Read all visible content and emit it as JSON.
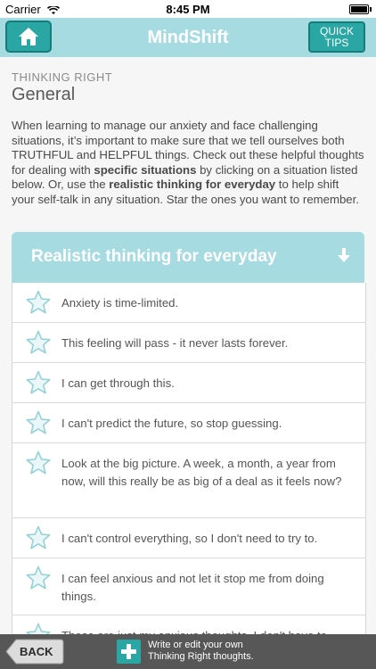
{
  "status": {
    "carrier": "Carrier",
    "time": "8:45 PM"
  },
  "nav": {
    "title": "MindShift",
    "tips_line1": "QUICK",
    "tips_line2": "TIPS"
  },
  "page": {
    "section": "THINKING RIGHT",
    "title": "General",
    "intro": {
      "p1": "When learning to manage our anxiety and face challenging situations, it’s important to make sure that we tell ourselves both TRUTHFUL and HELPFUL things. Check out these helpful thoughts for dealing with ",
      "b1": "specific situations",
      "p2": " by clicking on a situation listed below. Or, use the ",
      "b2": "realistic thinking for everyday",
      "p3": " to help shift your self-talk in any situation. Star the ones you want to remember."
    }
  },
  "card": {
    "title": "Realistic thinking for everyday"
  },
  "thoughts": [
    "Anxiety is time-limited.",
    "This feeling will pass - it never lasts forever.",
    "I can get through this.",
    "I can't predict the future, so stop guessing.",
    "Look at the big picture. A week, a month, a year from now, will this really be as big of a deal as it feels now?",
    "I can't control everything, so I don't need to try to.",
    "I can feel anxious and not let it stop me from doing things.",
    "These are just my anxious thoughts. I don't have to listen to them."
  ],
  "toolbar": {
    "back": "BACK",
    "edit_line1": "Write or edit your own",
    "edit_line2": "Thinking Right thoughts."
  },
  "colors": {
    "accent": "#2aa7a4",
    "header": "#a7dbe2",
    "toolbar": "#575757"
  }
}
